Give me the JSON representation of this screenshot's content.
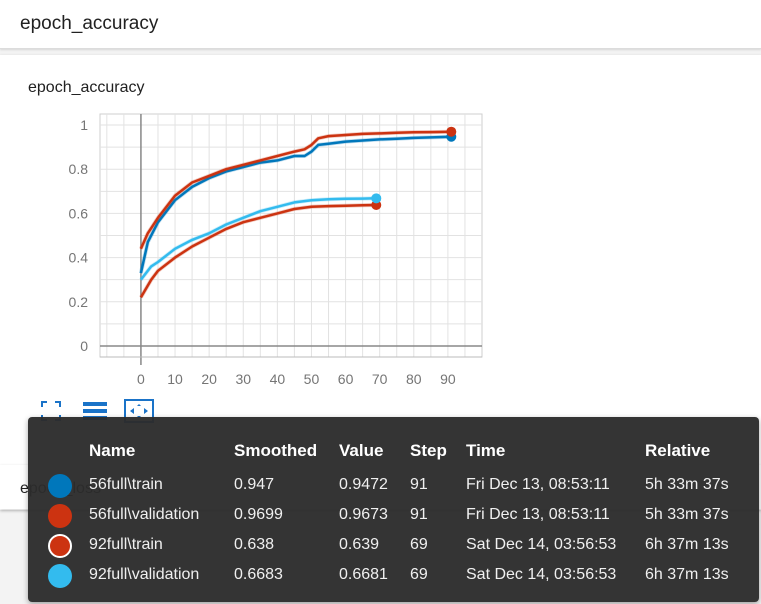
{
  "header": {
    "title": "epoch_accuracy"
  },
  "card": {
    "title": "epoch_accuracy"
  },
  "second_card": {
    "title_partial": "epoch_loss"
  },
  "toolbar": {
    "icons": [
      "fullscreen-icon",
      "data-selection-icon",
      "fit-domain-icon"
    ]
  },
  "chart_data": {
    "type": "line",
    "title": "epoch_accuracy",
    "xlabel": "",
    "ylabel": "",
    "xlim": [
      -12,
      100
    ],
    "ylim": [
      -0.05,
      1.05
    ],
    "xticks": [
      0,
      10,
      20,
      30,
      40,
      50,
      60,
      70,
      80,
      90
    ],
    "yticks": [
      0,
      0.2,
      0.4,
      0.6,
      0.8,
      1
    ],
    "grid": true,
    "series": [
      {
        "name": "56full\\train",
        "color": "#0077bb",
        "x": [
          0,
          2,
          5,
          10,
          15,
          20,
          25,
          30,
          35,
          40,
          45,
          48,
          50,
          52,
          55,
          60,
          65,
          70,
          75,
          80,
          85,
          91
        ],
        "y": [
          0.33,
          0.47,
          0.56,
          0.66,
          0.72,
          0.76,
          0.79,
          0.81,
          0.83,
          0.84,
          0.86,
          0.86,
          0.88,
          0.91,
          0.915,
          0.925,
          0.93,
          0.935,
          0.938,
          0.942,
          0.944,
          0.947
        ]
      },
      {
        "name": "56full\\validation",
        "color": "#cc3311",
        "x": [
          0,
          2,
          5,
          10,
          15,
          20,
          25,
          30,
          35,
          40,
          45,
          48,
          50,
          52,
          55,
          60,
          65,
          70,
          75,
          80,
          85,
          91
        ],
        "y": [
          0.44,
          0.51,
          0.58,
          0.68,
          0.74,
          0.77,
          0.8,
          0.82,
          0.84,
          0.86,
          0.88,
          0.89,
          0.91,
          0.94,
          0.95,
          0.955,
          0.96,
          0.962,
          0.965,
          0.967,
          0.968,
          0.9699
        ]
      },
      {
        "name": "92full\\train",
        "color": "#cc3311",
        "x": [
          0,
          3,
          5,
          10,
          15,
          20,
          25,
          30,
          35,
          40,
          45,
          50,
          55,
          60,
          65,
          69
        ],
        "y": [
          0.22,
          0.3,
          0.34,
          0.4,
          0.45,
          0.49,
          0.53,
          0.56,
          0.58,
          0.6,
          0.62,
          0.63,
          0.633,
          0.635,
          0.637,
          0.638
        ]
      },
      {
        "name": "92full\\validation",
        "color": "#33bbee",
        "x": [
          0,
          3,
          5,
          10,
          15,
          20,
          25,
          30,
          35,
          40,
          45,
          50,
          55,
          60,
          65,
          69
        ],
        "y": [
          0.3,
          0.36,
          0.38,
          0.44,
          0.48,
          0.51,
          0.55,
          0.58,
          0.61,
          0.63,
          0.65,
          0.66,
          0.664,
          0.666,
          0.667,
          0.6683
        ]
      }
    ]
  },
  "tooltip": {
    "headers": [
      "Name",
      "Smoothed",
      "Value",
      "Step",
      "Time",
      "Relative"
    ],
    "rows": [
      {
        "name": "56full\\train",
        "smoothed": "0.947",
        "value": "0.9472",
        "step": "91",
        "time": "Fri Dec 13, 08:53:11",
        "relative": "5h 33m 37s",
        "color": "#0077bb",
        "ring": false
      },
      {
        "name": "56full\\validation",
        "smoothed": "0.9699",
        "value": "0.9673",
        "step": "91",
        "time": "Fri Dec 13, 08:53:11",
        "relative": "5h 33m 37s",
        "color": "#cc3311",
        "ring": false
      },
      {
        "name": "92full\\train",
        "smoothed": "0.638",
        "value": "0.639",
        "step": "69",
        "time": "Sat Dec 14, 03:56:53",
        "relative": "6h 37m 13s",
        "color": "#cc3311",
        "ring": true
      },
      {
        "name": "92full\\validation",
        "smoothed": "0.6683",
        "value": "0.6681",
        "step": "69",
        "time": "Sat Dec 14, 03:56:53",
        "relative": "6h 37m 13s",
        "color": "#33bbee",
        "ring": false
      }
    ]
  }
}
